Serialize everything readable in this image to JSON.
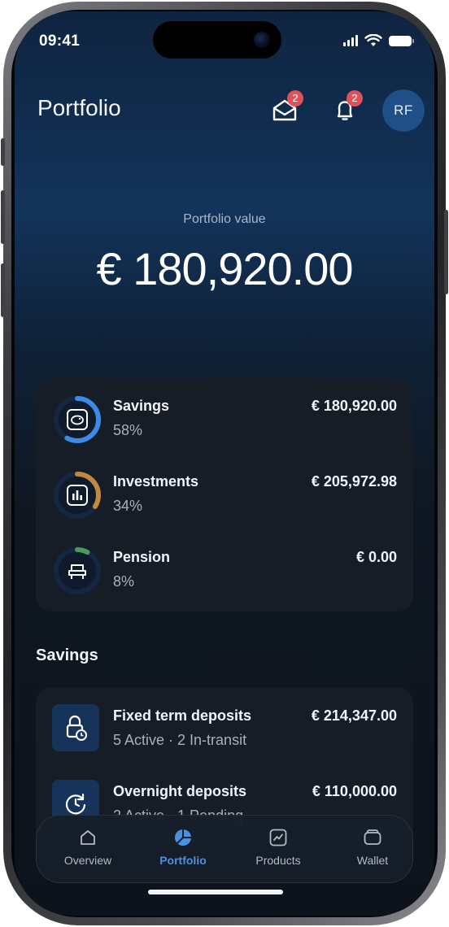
{
  "status_bar": {
    "time": "09:41"
  },
  "header": {
    "title": "Portfolio",
    "mail_badge": "2",
    "notification_badge": "2",
    "avatar_initials": "RF"
  },
  "summary": {
    "label": "Portfolio value",
    "value": "€ 180,920.00"
  },
  "accounts": [
    {
      "name": "Savings",
      "percent": "58%",
      "amount": "€ 180,920.00",
      "icon": "piggy-bank-icon",
      "ring_color": "#3d8ae6",
      "fill": 0.58
    },
    {
      "name": "Investments",
      "percent": "34%",
      "amount": "€ 205,972.98",
      "icon": "chart-bars-icon",
      "ring_color": "#c08a3e",
      "fill": 0.34
    },
    {
      "name": "Pension",
      "percent": "8%",
      "amount": "€ 0.00",
      "icon": "armchair-icon",
      "ring_color": "#4e9a5a",
      "fill": 0.08
    }
  ],
  "savings_section": {
    "title": "Savings",
    "items": [
      {
        "name": "Fixed term deposits",
        "subtitle": "5 Active · 2 In-transit",
        "amount": "€ 214,347.00",
        "icon": "lock-clock-icon"
      },
      {
        "name": "Overnight deposits",
        "subtitle": "2 Active · 1 Pending",
        "amount": "€ 110,000.00",
        "icon": "clock-refresh-icon"
      }
    ]
  },
  "nav": {
    "active": "Portfolio",
    "items": [
      {
        "label": "Overview",
        "icon": "home-icon"
      },
      {
        "label": "Portfolio",
        "icon": "pie-chart-icon"
      },
      {
        "label": "Products",
        "icon": "chart-line-icon"
      },
      {
        "label": "Wallet",
        "icon": "wallet-icon"
      }
    ]
  },
  "colors": {
    "accent": "#4a90e2",
    "badge": "#e0525a",
    "card": "#161d27"
  }
}
